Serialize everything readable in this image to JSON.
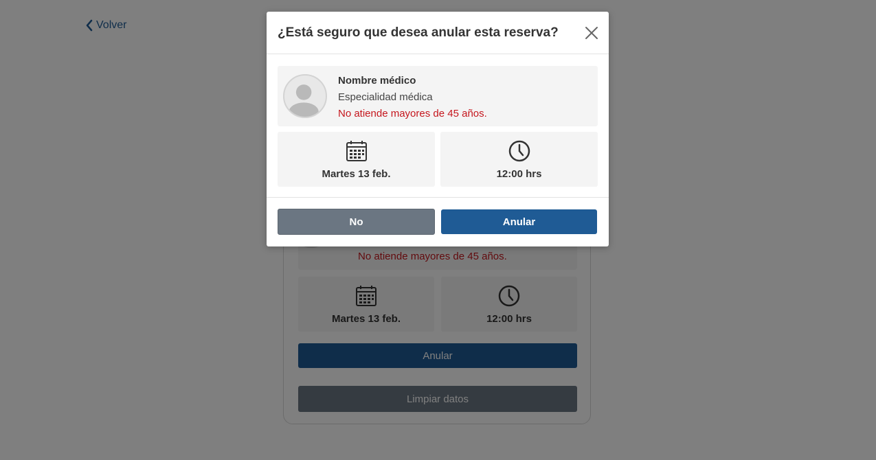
{
  "back": {
    "label": "Volver",
    "icon": "chevron-left-icon"
  },
  "background_card": {
    "doctor_warning": "No atiende mayores de 45 años.",
    "date": "Martes 13 feb.",
    "time": "12:00 hrs",
    "annul_label": "Anular",
    "clear_label": "Limpiar datos"
  },
  "modal": {
    "title": "¿Está seguro que desea anular esta reserva?",
    "close_icon": "close-icon",
    "doctor": {
      "name": "Nombre médico",
      "specialty": "Especialidad médica",
      "warning": "No atiende mayores de 45 años."
    },
    "date": {
      "icon": "calendar-icon",
      "label": "Martes 13 feb."
    },
    "time": {
      "icon": "clock-icon",
      "label": "12:00 hrs"
    },
    "no_label": "No",
    "annul_label": "Anular"
  },
  "colors": {
    "primary": "#1f5b95",
    "secondary": "#6b7682",
    "warning": "#c5161d",
    "overlay": "rgba(0,0,0,0.5)"
  }
}
